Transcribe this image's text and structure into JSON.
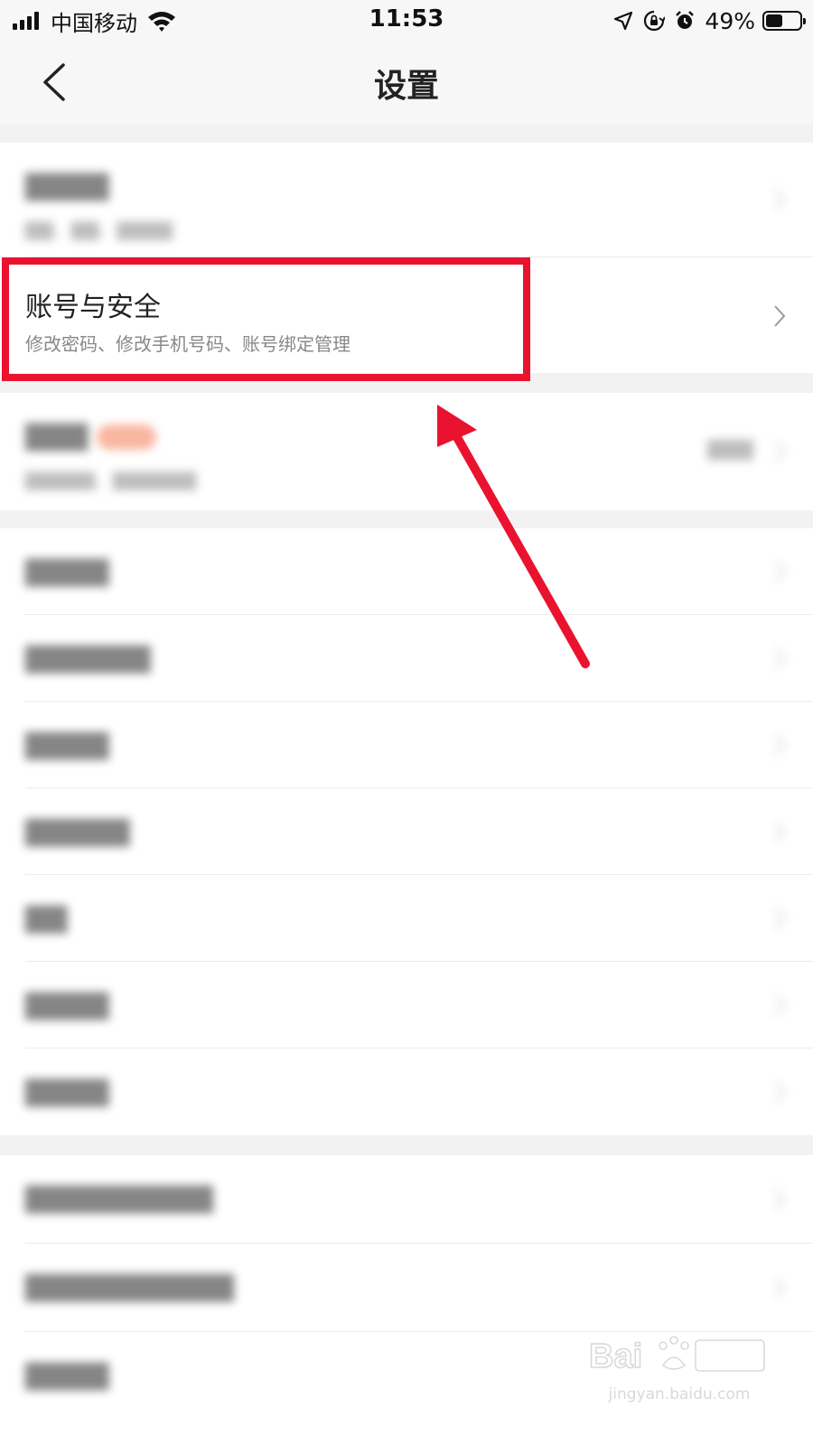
{
  "status_bar": {
    "carrier": "中国移动",
    "time": "11:53",
    "battery_percent": "49%",
    "battery_level": 0.49,
    "icons": [
      "signal-icon",
      "wifi-icon",
      "location-icon",
      "rotation-lock-icon",
      "alarm-icon",
      "battery-icon"
    ]
  },
  "nav": {
    "title": "设置",
    "back_icon": "chevron-left-icon"
  },
  "settings": {
    "account_security": {
      "title": "账号与安全",
      "subtitle": "修改密码、修改手机号码、账号绑定管理"
    },
    "blurred_rows_count_note": "",
    "blurred_groups": {
      "first_group": 1,
      "second_group": 1,
      "third_group": 7,
      "fourth_group": 3
    }
  },
  "annotation": {
    "highlight_color": "#e91330",
    "arrow_color": "#e91330"
  },
  "watermark": {
    "url": "jingyan.baidu.com"
  },
  "colors": {
    "background": "#ffffff",
    "header": "#f7f7f7",
    "separator": "#f2f2f2",
    "badge": "#f47a55"
  }
}
